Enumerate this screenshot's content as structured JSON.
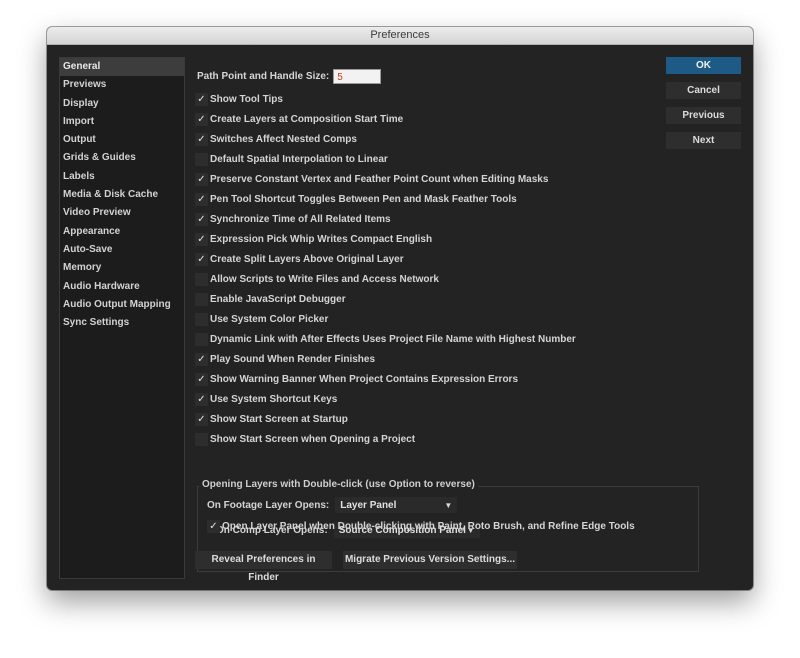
{
  "window": {
    "title": "Preferences"
  },
  "sidebar": {
    "items": [
      {
        "label": "General",
        "selected": true
      },
      {
        "label": "Previews"
      },
      {
        "label": "Display"
      },
      {
        "label": "Import"
      },
      {
        "label": "Output"
      },
      {
        "label": "Grids & Guides"
      },
      {
        "label": "Labels"
      },
      {
        "label": "Media & Disk Cache"
      },
      {
        "label": "Video Preview"
      },
      {
        "label": "Appearance"
      },
      {
        "label": "Auto-Save"
      },
      {
        "label": "Memory"
      },
      {
        "label": "Audio Hardware"
      },
      {
        "label": "Audio Output Mapping"
      },
      {
        "label": "Sync Settings"
      }
    ]
  },
  "general": {
    "path_point_label": "Path Point and Handle Size:",
    "path_point_value": "5",
    "checkboxes": [
      {
        "label": "Show Tool Tips",
        "checked": true
      },
      {
        "label": "Create Layers at Composition Start Time",
        "checked": true
      },
      {
        "label": "Switches Affect Nested Comps",
        "checked": true
      },
      {
        "label": "Default Spatial Interpolation to Linear",
        "checked": false
      },
      {
        "label": "Preserve Constant Vertex and Feather Point Count when Editing Masks",
        "checked": true
      },
      {
        "label": "Pen Tool Shortcut Toggles Between Pen and Mask Feather Tools",
        "checked": true
      },
      {
        "label": "Synchronize Time of All Related Items",
        "checked": true
      },
      {
        "label": "Expression Pick Whip Writes Compact English",
        "checked": true
      },
      {
        "label": "Create Split Layers Above Original Layer",
        "checked": true
      },
      {
        "label": "Allow Scripts to Write Files and Access Network",
        "checked": false
      },
      {
        "label": "Enable JavaScript Debugger",
        "checked": false
      },
      {
        "label": "Use System Color Picker",
        "checked": false
      },
      {
        "label": "Dynamic Link with After Effects Uses Project File Name with Highest Number",
        "checked": false
      },
      {
        "label": "Play Sound When Render Finishes",
        "checked": true
      },
      {
        "label": "Show Warning Banner When Project Contains Expression Errors",
        "checked": true
      },
      {
        "label": "Use System Shortcut Keys",
        "checked": true
      },
      {
        "label": "Show Start Screen at Startup",
        "checked": true
      },
      {
        "label": "Show Start Screen when Opening a Project",
        "checked": false
      }
    ],
    "double_click_group": {
      "title": "Opening Layers with Double-click (use Option to reverse)",
      "footage_label": "On Footage Layer Opens:",
      "footage_value": "Layer Panel",
      "comp_label": "On Comp Layer Opens:",
      "comp_value": "Source Composition Panel",
      "paint_label": "Open Layer Panel when Double-clicking with Paint, Roto Brush, and Refine Edge Tools",
      "paint_checked": true
    },
    "reveal_button": "Reveal Preferences in Finder",
    "migrate_button": "Migrate Previous Version Settings..."
  },
  "buttons": {
    "ok": "OK",
    "cancel": "Cancel",
    "previous": "Previous",
    "next": "Next"
  },
  "icons": {
    "check": "checkmark-icon",
    "dropdown": "chevron-down-icon"
  }
}
